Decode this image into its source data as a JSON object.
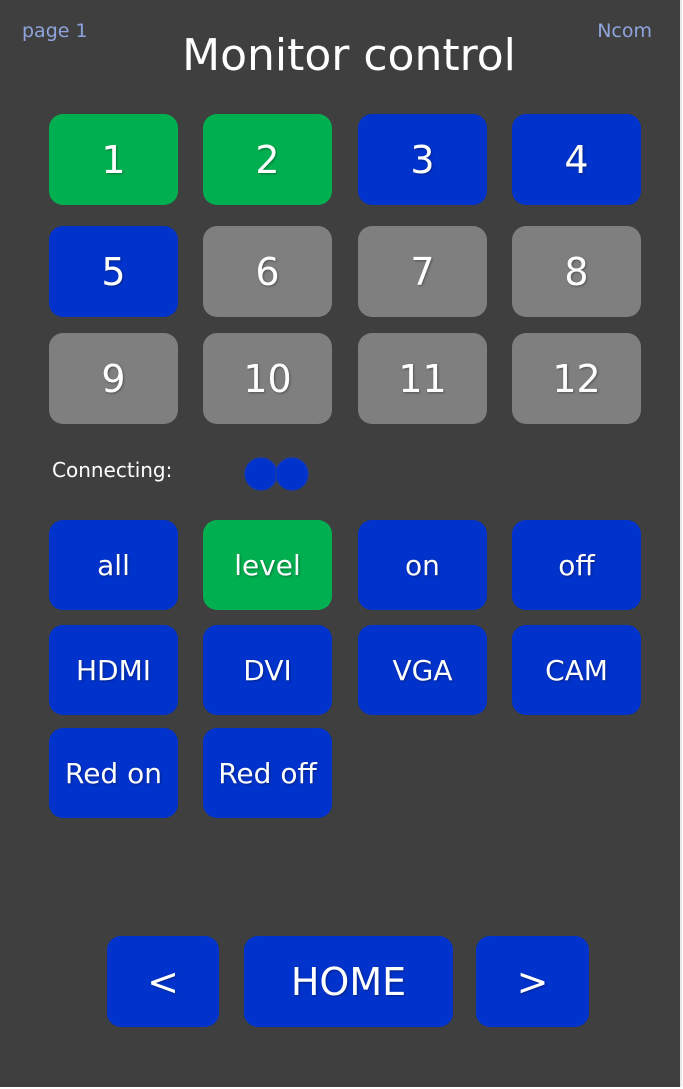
{
  "header": {
    "page": "page 1",
    "title": "Monitor control",
    "brand": "Ncom"
  },
  "monitors": [
    {
      "label": "1",
      "state": "active",
      "color": "#00b050"
    },
    {
      "label": "2",
      "state": "active",
      "color": "#00b050"
    },
    {
      "label": "3",
      "state": "available",
      "color": "#0033cc"
    },
    {
      "label": "4",
      "state": "available",
      "color": "#0033cc"
    },
    {
      "label": "5",
      "state": "available",
      "color": "#0033cc"
    },
    {
      "label": "6",
      "state": "disabled",
      "color": "#7f7f7f"
    },
    {
      "label": "7",
      "state": "disabled",
      "color": "#7f7f7f"
    },
    {
      "label": "8",
      "state": "disabled",
      "color": "#7f7f7f"
    },
    {
      "label": "9",
      "state": "disabled",
      "color": "#7f7f7f"
    },
    {
      "label": "10",
      "state": "disabled",
      "color": "#7f7f7f"
    },
    {
      "label": "11",
      "state": "disabled",
      "color": "#7f7f7f"
    },
    {
      "label": "12",
      "state": "disabled",
      "color": "#7f7f7f"
    }
  ],
  "status": {
    "label": "Connecting:",
    "indicator_icon": "connecting-dots-icon",
    "color": "#0033cc"
  },
  "functions": {
    "all": "all",
    "level": "level",
    "on": "on",
    "off": "off",
    "hdmi": "HDMI",
    "dvi": "DVI",
    "vga": "VGA",
    "cam": "CAM",
    "red_on": "Red on",
    "red_off": "Red off"
  },
  "nav": {
    "prev": "<",
    "home": "HOME",
    "next": ">"
  },
  "colors": {
    "background": "#3f3f3f",
    "blue": "#0033cc",
    "green": "#00b050",
    "grey": "#7f7f7f",
    "corner_text": "#8fa4dc"
  }
}
